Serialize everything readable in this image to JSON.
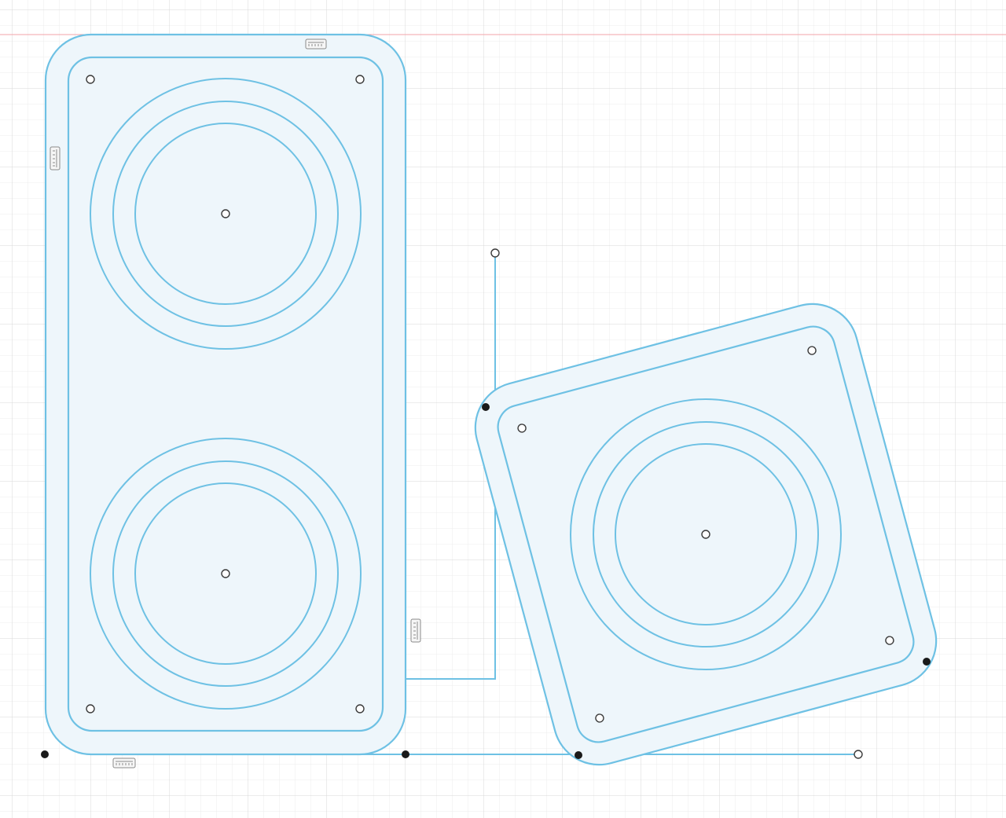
{
  "view": {
    "name": "sketch-view",
    "colors": {
      "background": "#ffffff",
      "grid_minor": "#ececec",
      "grid_major": "#d9d9d9",
      "axis_red": "#f3a3a8",
      "sketch_line": "#6ec1e4",
      "profile_fill": "#eef6fb",
      "point_open": "#ffffff",
      "point_fixed": "#1a1a1a",
      "constraint_glyph": "#8a8a8a"
    }
  },
  "sketch": {
    "profiles": [
      {
        "name": "rectangular-speaker-plate",
        "kind": "rounded-rectangle",
        "holes": 4,
        "driver_cutouts": 2
      },
      {
        "name": "rotated-square-speaker-plate",
        "kind": "rotated-rounded-square",
        "holes": 4,
        "driver_cutouts": 1
      }
    ],
    "constraint_icons": [
      "horizontal-constraint-icon",
      "vertical-constraint-icon",
      "vertical-constraint-icon",
      "horizontal-constraint-icon"
    ],
    "point_styles": [
      "open-sketch-point",
      "fixed-sketch-point"
    ]
  }
}
